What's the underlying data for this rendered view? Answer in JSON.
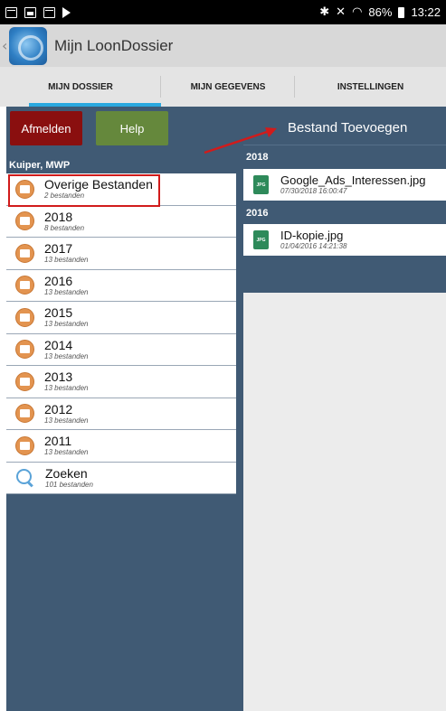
{
  "statusbar": {
    "battery_text": "86%",
    "time": "13:22",
    "bluetooth_glyph": "✱",
    "mute_glyph": "✕",
    "wifi_glyph": "◠"
  },
  "app": {
    "title": "Mijn LoonDossier"
  },
  "tabs": [
    {
      "label": "MIJN DOSSIER"
    },
    {
      "label": "MIJN GEGEVENS"
    },
    {
      "label": "INSTELLINGEN"
    }
  ],
  "left": {
    "logout_label": "Afmelden",
    "help_label": "Help",
    "user_label": "Kuiper, MWP",
    "folders": [
      {
        "name": "Overige Bestanden",
        "count": "2 bestanden"
      },
      {
        "name": "2018",
        "count": "8 bestanden"
      },
      {
        "name": "2017",
        "count": "13 bestanden"
      },
      {
        "name": "2016",
        "count": "13 bestanden"
      },
      {
        "name": "2015",
        "count": "13 bestanden"
      },
      {
        "name": "2014",
        "count": "13 bestanden"
      },
      {
        "name": "2013",
        "count": "13 bestanden"
      },
      {
        "name": "2012",
        "count": "13 bestanden"
      },
      {
        "name": "2011",
        "count": "13 bestanden"
      },
      {
        "name": "Zoeken",
        "count": "101 bestanden"
      }
    ]
  },
  "right": {
    "add_file_label": "Bestand Toevoegen",
    "sections": [
      {
        "header": "2018",
        "file_name": "Google_Ads_Interessen.jpg",
        "file_date": "07/30/2018 16:00:47",
        "file_type": "JPG"
      },
      {
        "header": "2016",
        "file_name": "ID-kopie.jpg",
        "file_date": "01/04/2016 14:21:38",
        "file_type": "JPG"
      }
    ]
  },
  "colors": {
    "panel": "#405a74",
    "logout": "#8a0f0f",
    "help": "#65883c",
    "tab_indicator": "#2aa9e0",
    "annotation": "#d11b1b"
  }
}
